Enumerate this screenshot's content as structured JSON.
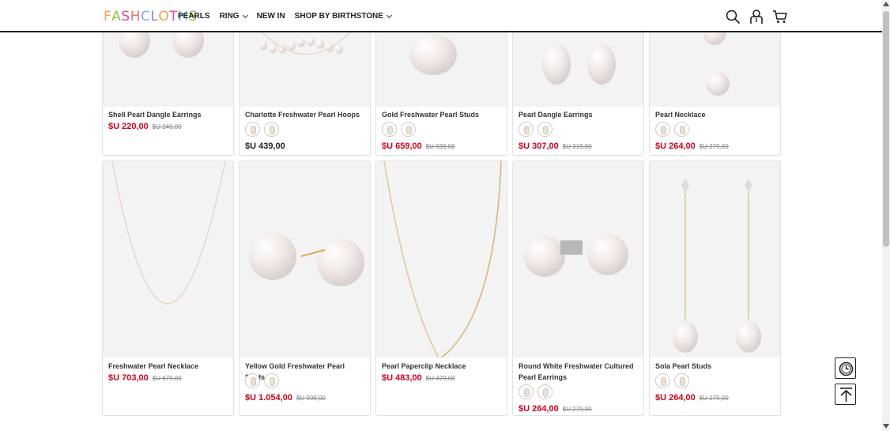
{
  "header": {
    "logo_letters": [
      "F",
      "A",
      "S",
      "H",
      "C",
      "L",
      "O",
      "T",
      "H",
      "S"
    ],
    "logo_colors": [
      "#f2a24a",
      "#8dc63f",
      "#e84e9b",
      "#f36f6f",
      "#6fb7e6",
      "#9b7fd1",
      "#f2a24a",
      "#e84e9b",
      "#6fb7e6",
      "#8dc63f"
    ],
    "nav": [
      {
        "label": "PEARLS",
        "dropdown": false
      },
      {
        "label": "RING",
        "dropdown": true
      },
      {
        "label": "NEW IN",
        "dropdown": false
      },
      {
        "label": "SHOP BY BIRTHSTONE",
        "dropdown": true
      }
    ],
    "icons": [
      "search-icon",
      "user-icon",
      "cart-icon"
    ]
  },
  "currency": "$U",
  "products": [
    {
      "name": "Shell Pearl Dangle Earrings",
      "price": "$U 220,00",
      "old_price": "$U 240,00",
      "swatches": 0
    },
    {
      "name": "Charlotte Freshwater Pearl Hoops",
      "price": "$U 439,00",
      "old_price": "",
      "swatches": 2
    },
    {
      "name": "Gold Freshwater Pearl Studs",
      "price": "$U 659,00",
      "old_price": "$U 639,00",
      "swatches": 2
    },
    {
      "name": "Pearl Dangle Earrings",
      "price": "$U 307,00",
      "old_price": "$U 319,00",
      "swatches": 2
    },
    {
      "name": "Pearl Necklace",
      "price": "$U 264,00",
      "old_price": "$U 279,00",
      "swatches": 2
    },
    {
      "name": "Freshwater Pearl Necklace",
      "price": "$U 703,00",
      "old_price": "$U 679,00",
      "swatches": 0
    },
    {
      "name": "Yellow Gold Freshwater Pearl Studs",
      "price": "$U 1.054,00",
      "old_price": "$U 998,00",
      "swatches": 2
    },
    {
      "name": "Pearl Paperclip Necklace",
      "price": "$U 483,00",
      "old_price": "$U 479,00",
      "swatches": 0
    },
    {
      "name": "Round White Freshwater Cultured Pearl Earrings",
      "price": "$U 264,00",
      "old_price": "$U 279,00",
      "swatches": 2
    },
    {
      "name": "Sola Pearl Studs",
      "price": "$U 264,00",
      "old_price": "$U 279,00",
      "swatches": 2
    }
  ],
  "floating": [
    "clock-icon",
    "back-to-top-icon"
  ]
}
